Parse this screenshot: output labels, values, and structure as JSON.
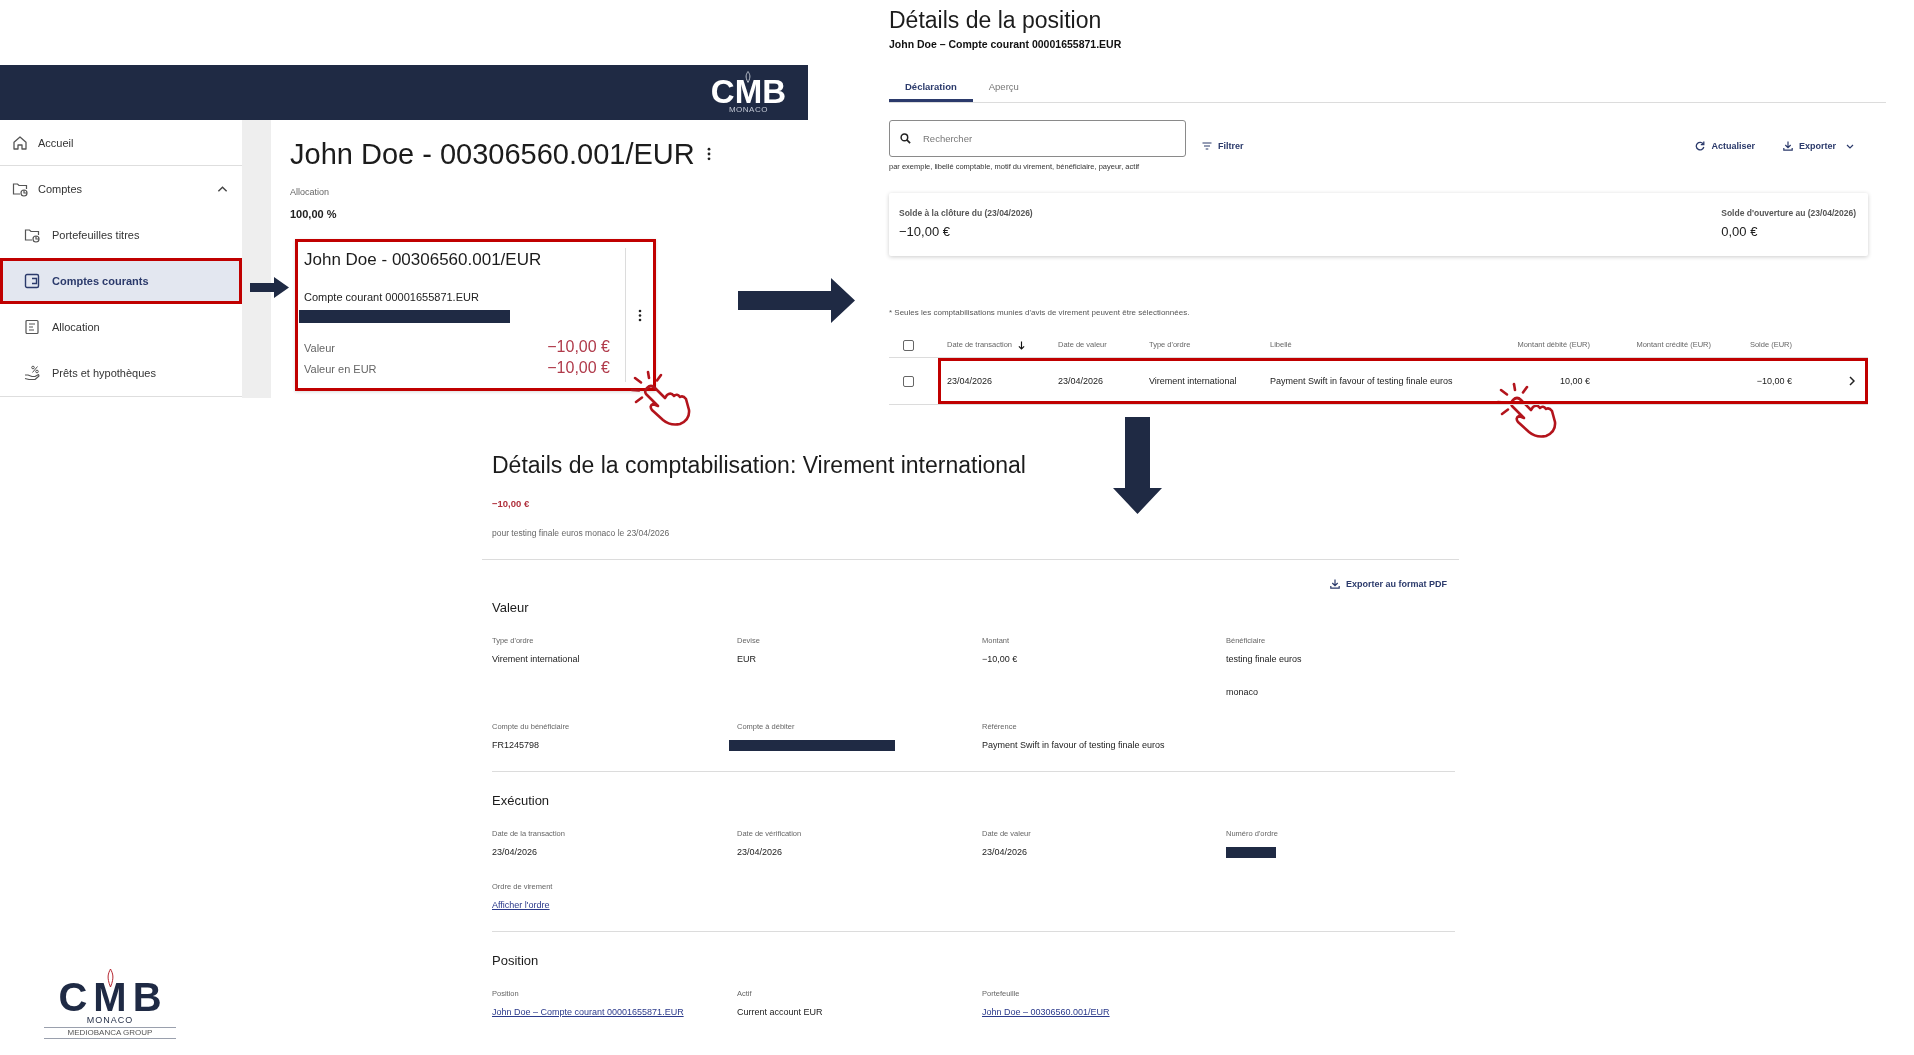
{
  "app_panel": {
    "header_logo": {
      "wordmark": "CMB",
      "subtitle": "MONACO"
    },
    "sidebar": {
      "items": [
        {
          "label": "Accueil",
          "selected": false,
          "highlighted": false
        },
        {
          "label": "Comptes",
          "selected": false,
          "highlighted": false,
          "expanded": true,
          "children": [
            {
              "label": "Portefeuilles titres",
              "selected": false,
              "highlighted": false
            },
            {
              "label": "Comptes courants",
              "selected": true,
              "highlighted": true
            },
            {
              "label": "Allocation",
              "selected": false,
              "highlighted": false
            },
            {
              "label": "Prêts et hypothèques",
              "selected": false,
              "highlighted": false
            }
          ]
        }
      ]
    },
    "title": "John Doe - 00306560.001/EUR",
    "allocation": {
      "label": "Allocation",
      "value": "100,00 %"
    },
    "cards": [
      {
        "title": "John Doe - 00306560.001/EUR",
        "subtitle": "Compte courant 00001655871.EUR",
        "redacted": true,
        "highlighted": true,
        "click_marker": true,
        "rows": [
          {
            "label": "Valeur",
            "value": "−10,00 €"
          },
          {
            "label": "Valeur en EUR",
            "value": "−10,00 €"
          }
        ]
      }
    ]
  },
  "position_panel": {
    "title": "Détails de la position",
    "subtitle": "John Doe – Compte courant 00001655871.EUR",
    "tabs": [
      {
        "label": "Déclaration",
        "selected": true
      },
      {
        "label": "Aperçu",
        "selected": false
      }
    ],
    "search": {
      "placeholder": "Rechercher",
      "hint": "par exemple, libellé comptable, motif du virement, bénéficiaire, payeur, actif"
    },
    "filter_button": "Filtrer",
    "refresh_button": "Actualiser",
    "export_button": "Exporter",
    "balances": [
      {
        "label": "Solde à la clôture du (23/04/2026)",
        "value": "−10,00 €"
      },
      {
        "label": "Solde d'ouverture au (23/04/2026)",
        "value": "0,00 €"
      }
    ],
    "note": "* Seules les comptabilisations munies d'avis de virement peuvent être sélectionnées.",
    "table": {
      "all_checked": false,
      "columns": [
        {
          "label": "Date de transaction",
          "kind": "text",
          "sorted": true
        },
        {
          "label": "Date de valeur",
          "kind": "text",
          "sorted": false
        },
        {
          "label": "Type d'ordre",
          "kind": "text",
          "sorted": false
        },
        {
          "label": "Libellé",
          "kind": "text",
          "sorted": false
        },
        {
          "label": "Montant débité (EUR)",
          "kind": "amount",
          "sorted": false
        },
        {
          "label": "Montant crédité (EUR)",
          "kind": "amount",
          "sorted": false
        },
        {
          "label": "Solde (EUR)",
          "kind": "amount",
          "sorted": false
        }
      ],
      "rows": [
        {
          "selected": false,
          "highlighted": true,
          "click_marker": true,
          "transaction_date": "23/04/2026",
          "value_date": "23/04/2026",
          "order_type": "Virement international",
          "description": "Payment Swift in favour of testing finale euros",
          "debit": "10,00 €",
          "balance": "−10,00 €"
        }
      ]
    }
  },
  "booking_panel": {
    "title": "Détails de la comptabilisation: Virement international",
    "amount": "−10,00 €",
    "description": "pour testing finale euros monaco le 23/04/2026",
    "export_button": "Exporter au format PDF",
    "sections": [
      {
        "title": "Valeur",
        "fields": [
          {
            "label": "Type d'ordre",
            "kind": "text",
            "value": "Virement international"
          },
          {
            "label": "Devise",
            "kind": "text",
            "value": "EUR"
          },
          {
            "label": "Montant",
            "kind": "text",
            "value": "−10,00 €"
          },
          {
            "label": "Bénéficiaire",
            "kind": "lines",
            "lines": [
              "testing finale euros",
              "monaco"
            ]
          },
          {
            "label": "Compte du bénéficiaire",
            "kind": "text",
            "value": "FR1245798"
          },
          {
            "label": "Compte à débiter",
            "kind": "redacted"
          },
          {
            "label": "Référence",
            "kind": "text",
            "value": "Payment Swift in favour of testing finale euros"
          }
        ]
      },
      {
        "title": "Exécution",
        "fields": [
          {
            "label": "Date de la transaction",
            "kind": "text",
            "value": "23/04/2026"
          },
          {
            "label": "Date de vérification",
            "kind": "text",
            "value": "23/04/2026"
          },
          {
            "label": "Date de valeur",
            "kind": "text",
            "value": "23/04/2026"
          },
          {
            "label": "Numéro d'ordre",
            "kind": "redacted"
          },
          {
            "label": "Ordre de virement",
            "kind": "link",
            "value": "Afficher l'ordre"
          }
        ]
      },
      {
        "title": "Position",
        "fields": [
          {
            "label": "Position",
            "kind": "link",
            "value": "John Doe – Compte courant 00001655871.EUR"
          },
          {
            "label": "Actif",
            "kind": "text",
            "value": "Current account EUR"
          },
          {
            "label": "Portefeuille",
            "kind": "link",
            "value": "John Doe – 00306560.001/EUR"
          }
        ]
      }
    ]
  },
  "footer_logo": {
    "wordmark": "CMB",
    "subtitle": "MONACO",
    "tagline": "MEDIOBANCA GROUP"
  }
}
